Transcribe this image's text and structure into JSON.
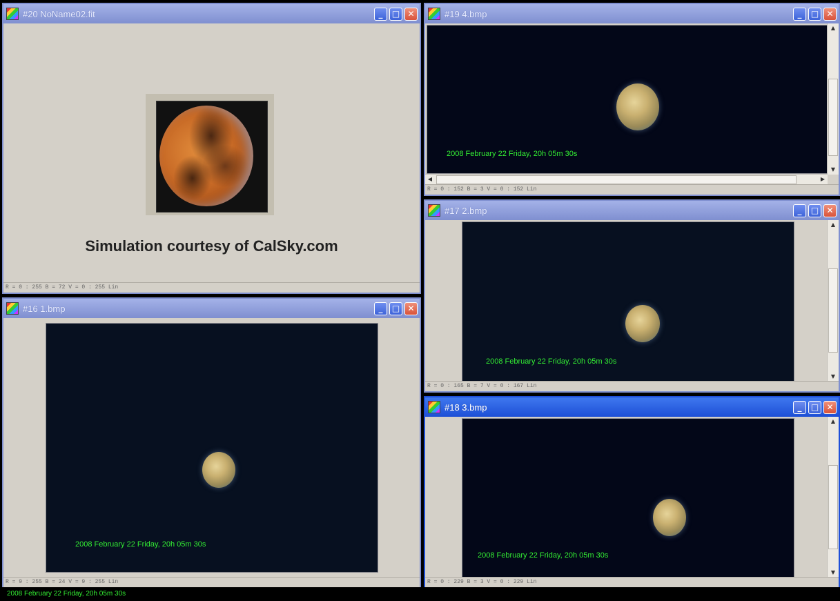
{
  "windows": {
    "w20": {
      "title": "#20 NoName02.fit",
      "status": "R = 0 : 255   B = 72   V = 0 : 255 Lin",
      "credit": "Simulation courtesy of CalSky.com"
    },
    "w19": {
      "title": "#19 4.bmp",
      "status": "R = 0 : 152   B = 3   V = 0 : 152 Lin",
      "stamp": "2008 February 22 Friday, 20h 05m 30s"
    },
    "w17": {
      "title": "#17 2.bmp",
      "status": "R = 0 : 165   B = 7   V = 0 : 167 Lin",
      "stamp": "2008 February 22 Friday, 20h 05m 30s"
    },
    "w18": {
      "title": "#18 3.bmp",
      "status": "R = 0 : 229   B = 3   V = 0 : 229 Lin",
      "stamp": "2008 February 22 Friday, 20h 05m 30s"
    },
    "w16": {
      "title": "#16 1.bmp",
      "status": "R = 9 : 255   B = 24   V = 9 : 255 Lin",
      "stamp": "2008 February 22 Friday, 20h 05m 30s"
    }
  },
  "controls": {
    "minimize": "_",
    "maximize": "□",
    "close": "✕",
    "up": "▲",
    "down": "▼",
    "left": "◀",
    "right": "▶"
  },
  "footer": {
    "stamp": "2008 February 22 Friday, 20h 05m 30s"
  },
  "colors": {
    "stamp": "#33ee33",
    "active_title": "#1d4fd6",
    "inactive_title": "#7f8fd0"
  },
  "icons": {
    "window": "color-grid-icon"
  }
}
